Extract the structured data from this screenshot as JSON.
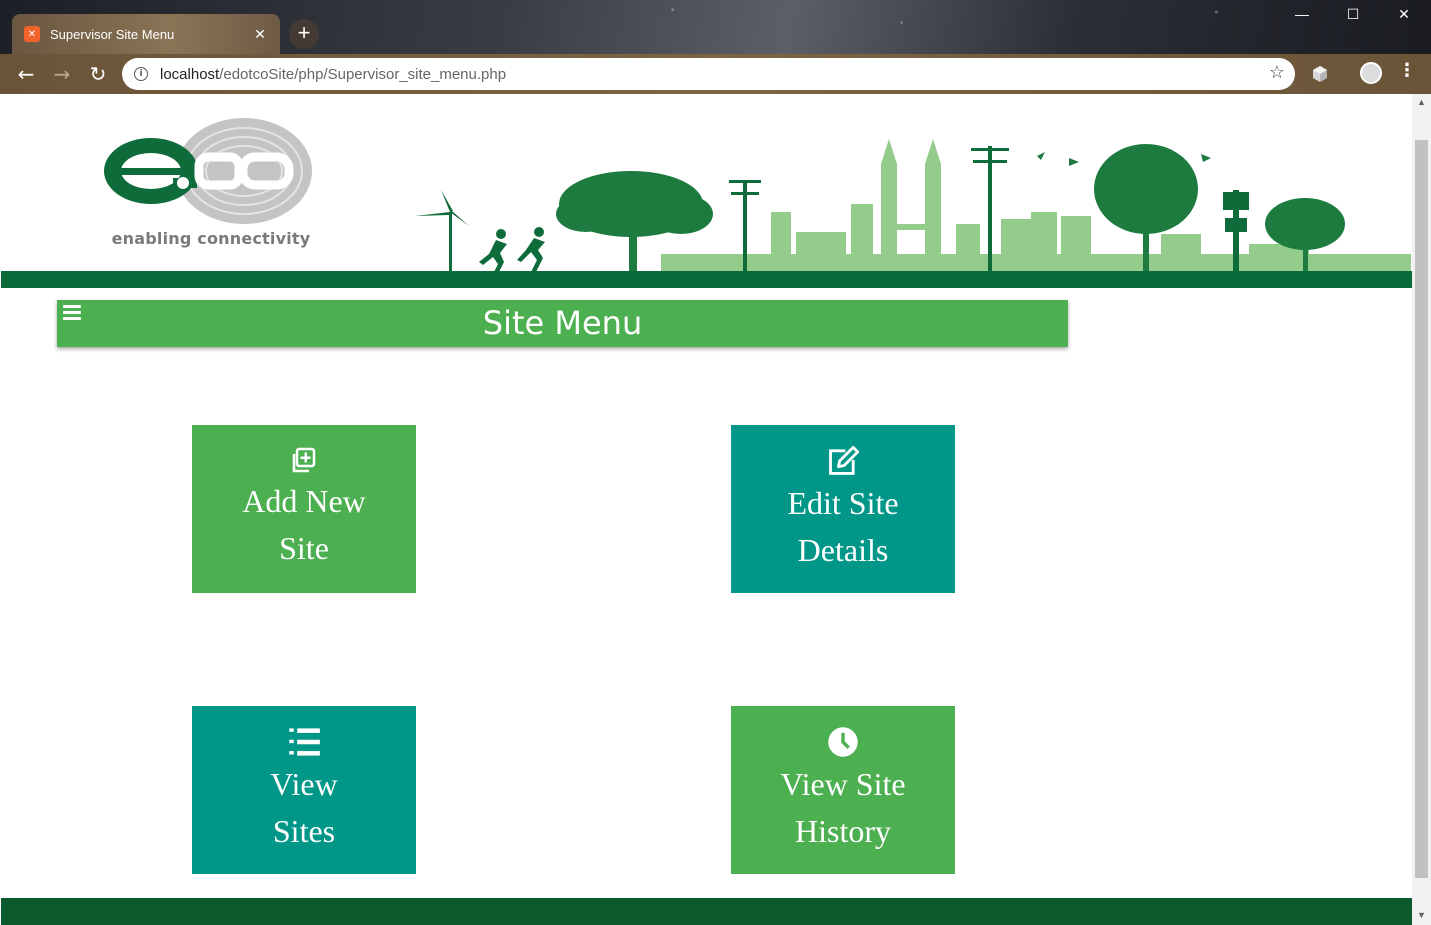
{
  "browser": {
    "tab_title": "Supervisor Site Menu",
    "tab_favicon": "xampp-icon",
    "url_host": "localhost",
    "url_path": "/edotcoSite/php/Supervisor_site_menu.php"
  },
  "header": {
    "logo_tagline": "enabling connectivity",
    "brand_green": "#0b6a3a",
    "logo_text": "e.co"
  },
  "menu": {
    "title": "Site Menu",
    "menu_icon": "hamburger-icon",
    "bar_color": "#4caf50"
  },
  "tiles": [
    {
      "line1": "Add New",
      "line2": "Site",
      "icon": "add-square-icon",
      "color": "#4caf50"
    },
    {
      "line1": "Edit Site",
      "line2": "Details",
      "icon": "edit-icon",
      "color": "#009688"
    },
    {
      "line1": "View",
      "line2": "Sites",
      "icon": "list-icon",
      "color": "#009688"
    },
    {
      "line1": "View Site",
      "line2": "History",
      "icon": "clock-icon",
      "color": "#4caf50"
    }
  ],
  "footer": {
    "color": "#0b5a2d"
  }
}
